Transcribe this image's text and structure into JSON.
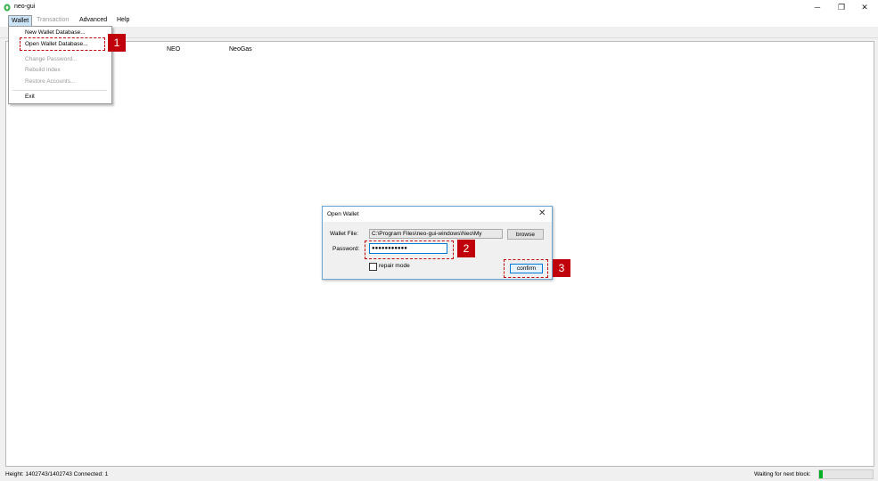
{
  "window": {
    "title": "neo-gui",
    "minimize_glyph": "─",
    "restore_glyph": "❐",
    "close_glyph": "✕"
  },
  "menubar": {
    "items": [
      {
        "label": "Wallet"
      },
      {
        "label": "Transaction"
      },
      {
        "label": "Advanced"
      },
      {
        "label": "Help"
      }
    ]
  },
  "wallet_menu": {
    "items": [
      {
        "label": "New Wallet Database..."
      },
      {
        "label": "Open Wallet Database..."
      },
      {
        "label": "Change Password..."
      },
      {
        "label": "Rebuild Index"
      },
      {
        "label": "Restore Accounts..."
      },
      {
        "label": "Exit"
      }
    ]
  },
  "list": {
    "columns": [
      "NEO",
      "NeoGas"
    ]
  },
  "dialog": {
    "title": "Open Wallet",
    "close_glyph": "✕",
    "wallet_file_label": "Wallet File:",
    "wallet_file_value": "C:\\Program Files\\neo-gui-windows\\Neo\\My",
    "browse_label": "browse",
    "password_label": "Password:",
    "password_value": "●●●●●●●●●●●",
    "repair_label": "repair mode",
    "confirm_label": "confirm"
  },
  "callouts": [
    "1",
    "2",
    "3"
  ],
  "status": {
    "height_text": "Height: 1402743/1402743  Connected: 1",
    "waiting_text": "Waiting for next block:",
    "progress": 0.07
  },
  "colors": {
    "accent": "#0078d7",
    "callout": "#c0000a",
    "progress": "#06b025"
  }
}
